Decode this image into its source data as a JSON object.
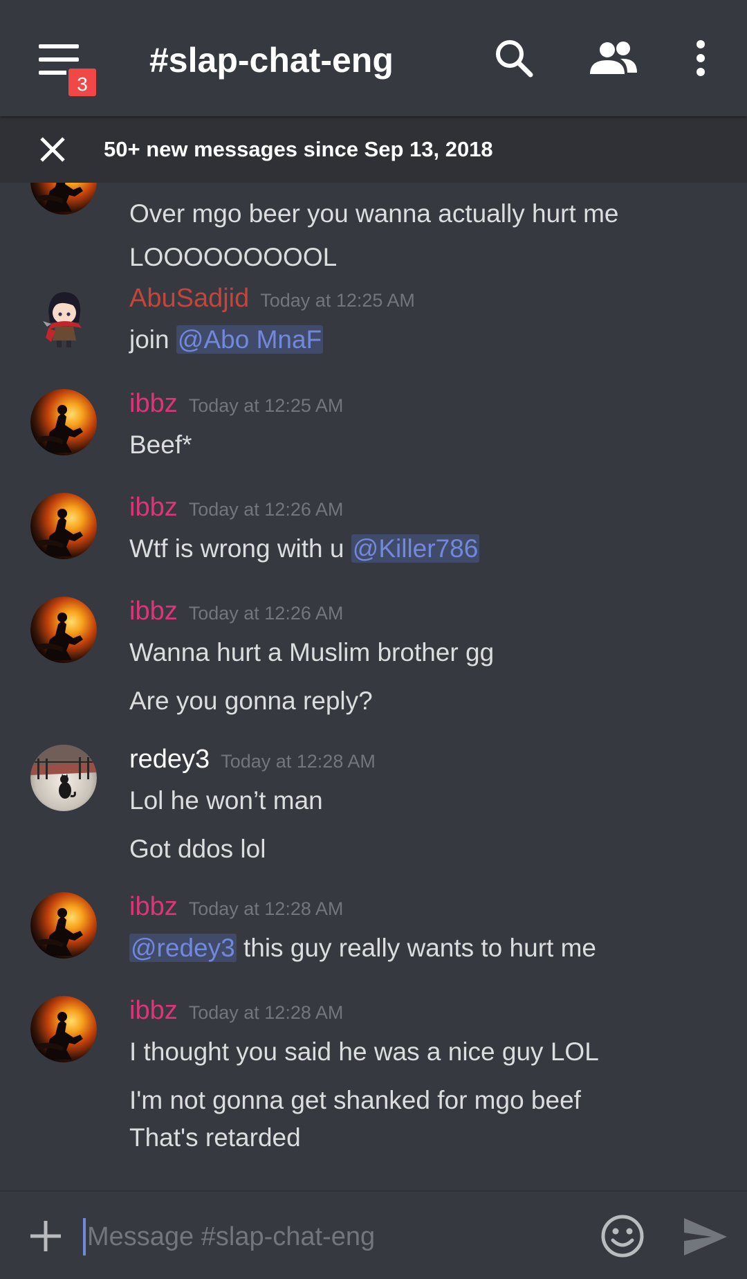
{
  "header": {
    "channel": "#slap-chat-eng",
    "notification_badge": "3",
    "icons": [
      "menu-icon",
      "search-icon",
      "members-icon",
      "more-vertical-icon"
    ]
  },
  "banner": {
    "text": "50+ new messages since Sep 13, 2018"
  },
  "messages": {
    "g0": {
      "lines": [
        "Over mgo beer you wanna actually hurt me",
        "LOOOOOOOOOL"
      ]
    },
    "g1": {
      "author": "AbuSadjid",
      "author_color": "#c6453b",
      "time": "Today at 12:25 AM",
      "line0_text": "join ",
      "line0_mention": "@Abo MnaF"
    },
    "g2": {
      "author": "ibbz",
      "author_color": "#e0337a",
      "time": "Today at 12:25 AM",
      "lines": [
        "Beef*"
      ]
    },
    "g3": {
      "author": "ibbz",
      "author_color": "#e0337a",
      "time": "Today at 12:26 AM",
      "line0_text": "Wtf is wrong with u ",
      "line0_mention": "@Killer786"
    },
    "g4": {
      "author": "ibbz",
      "author_color": "#e0337a",
      "time": "Today at 12:26 AM",
      "lines": [
        "Wanna hurt a Muslim brother gg",
        "Are you gonna reply?"
      ]
    },
    "g5": {
      "author": "redey3",
      "author_color": "#ffffff",
      "time": "Today at 12:28 AM",
      "lines": [
        "Lol he won’t man",
        "Got ddos lol"
      ]
    },
    "g6": {
      "author": "ibbz",
      "author_color": "#e0337a",
      "time": "Today at 12:28 AM",
      "line0_mention": "@redey3",
      "line0_text": " this guy really wants to hurt me"
    },
    "g7": {
      "author": "ibbz",
      "author_color": "#e0337a",
      "time": "Today at 12:28 AM",
      "lines": [
        "I thought you said he was a nice guy LOL",
        "I'm not gonna get shanked for mgo beef",
        "That's retarded"
      ]
    }
  },
  "composer": {
    "placeholder": "Message #slap-chat-eng"
  },
  "colors": {
    "background": "#36393f",
    "banner": "#2f3136",
    "mention_bg": "#404a69",
    "mention_text": "#7289da",
    "badge": "#f04747"
  }
}
